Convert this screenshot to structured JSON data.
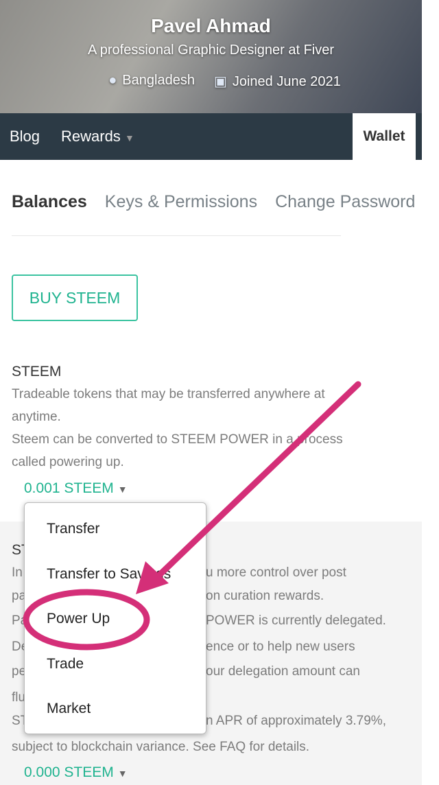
{
  "profile": {
    "name": "Pavel Ahmad",
    "bio": "A professional Graphic Designer at Fiver",
    "location": "Bangladesh",
    "joined": "Joined June 2021"
  },
  "nav": {
    "blog": "Blog",
    "rewards": "Rewards",
    "wallet": "Wallet"
  },
  "tabs": [
    "Balances",
    "Keys & Permissions",
    "Change Password"
  ],
  "buy_label": "BUY STEEM",
  "steem": {
    "title": "STEEM",
    "lines": [
      "Tradeable tokens that may be transferred anywhere at",
      "anytime.",
      "Steem can be converted to STEEM POWER in a process",
      "called powering up."
    ],
    "amount": "0.001 STEEM"
  },
  "steem_power": {
    "visible_fragments": [
      [
        "ST",
        ""
      ],
      [
        "In",
        "u more control over post"
      ],
      [
        "pa",
        "on curation rewards."
      ],
      [
        "Pa",
        "POWER is currently delegated."
      ],
      [
        "De",
        "ence or to help new users"
      ],
      [
        "pe",
        "our delegation amount can"
      ],
      [
        "flu",
        ""
      ],
      [
        "ST",
        "n APR of approximately 3.79%,"
      ]
    ],
    "last_line": "subject to blockchain variance. See FAQ for details.",
    "amount": "0.000 STEEM"
  },
  "menu": [
    "Transfer",
    "Transfer to Savings",
    "Power Up",
    "Trade",
    "Market"
  ],
  "colors": {
    "accent": "#1fb38f",
    "nav": "#2c3a45",
    "annotation": "#d42f78"
  }
}
